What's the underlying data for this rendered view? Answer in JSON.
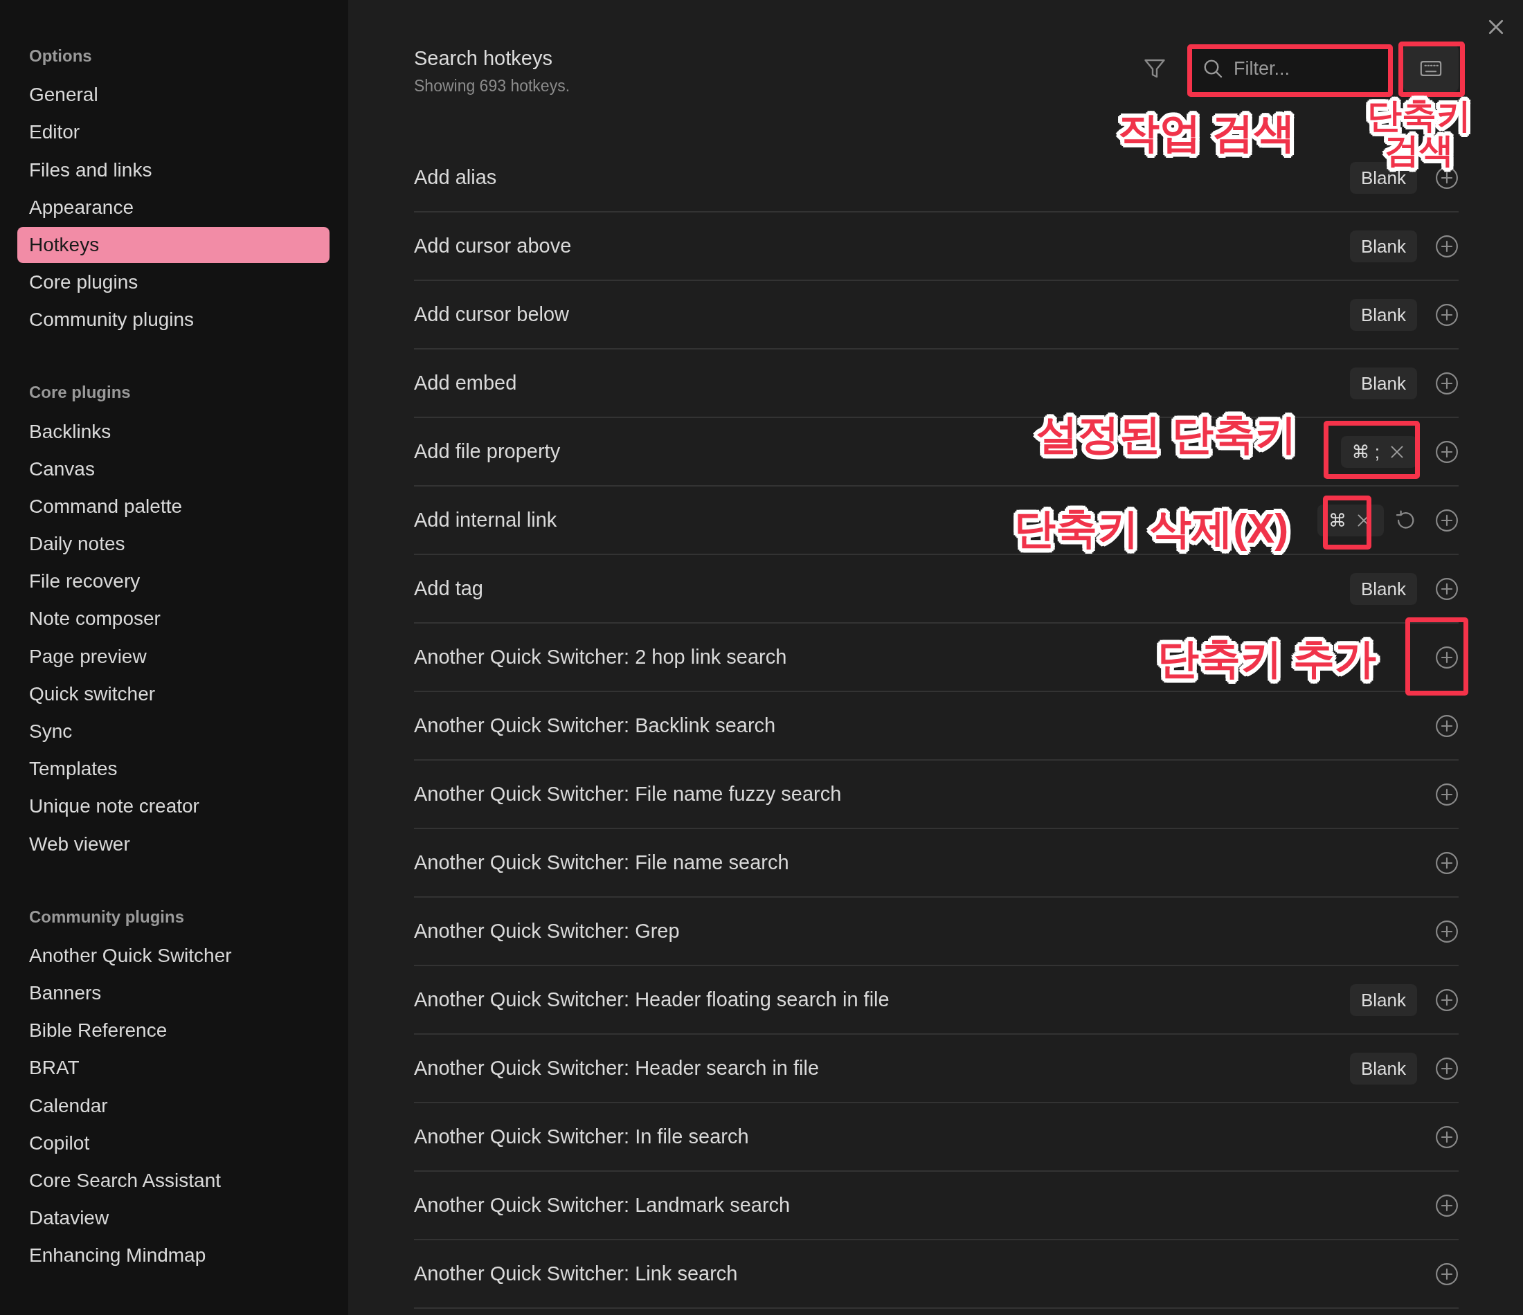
{
  "sidebar": {
    "sections": [
      {
        "heading": "Options",
        "items": [
          {
            "label": "General",
            "selected": false
          },
          {
            "label": "Editor",
            "selected": false
          },
          {
            "label": "Files and links",
            "selected": false
          },
          {
            "label": "Appearance",
            "selected": false
          },
          {
            "label": "Hotkeys",
            "selected": true
          },
          {
            "label": "Core plugins",
            "selected": false
          },
          {
            "label": "Community plugins",
            "selected": false
          }
        ]
      },
      {
        "heading": "Core plugins",
        "items": [
          {
            "label": "Backlinks",
            "selected": false
          },
          {
            "label": "Canvas",
            "selected": false
          },
          {
            "label": "Command palette",
            "selected": false
          },
          {
            "label": "Daily notes",
            "selected": false
          },
          {
            "label": "File recovery",
            "selected": false
          },
          {
            "label": "Note composer",
            "selected": false
          },
          {
            "label": "Page preview",
            "selected": false
          },
          {
            "label": "Quick switcher",
            "selected": false
          },
          {
            "label": "Sync",
            "selected": false
          },
          {
            "label": "Templates",
            "selected": false
          },
          {
            "label": "Unique note creator",
            "selected": false
          },
          {
            "label": "Web viewer",
            "selected": false
          }
        ]
      },
      {
        "heading": "Community plugins",
        "items": [
          {
            "label": "Another Quick Switcher",
            "selected": false
          },
          {
            "label": "Banners",
            "selected": false
          },
          {
            "label": "Bible Reference",
            "selected": false
          },
          {
            "label": "BRAT",
            "selected": false
          },
          {
            "label": "Calendar",
            "selected": false
          },
          {
            "label": "Copilot",
            "selected": false
          },
          {
            "label": "Core Search Assistant",
            "selected": false
          },
          {
            "label": "Dataview",
            "selected": false
          },
          {
            "label": "Enhancing Mindmap",
            "selected": false
          }
        ]
      }
    ]
  },
  "header": {
    "title": "Search hotkeys",
    "subtitle": "Showing 693 hotkeys.",
    "search": {
      "placeholder": "Filter..."
    }
  },
  "rows": [
    {
      "title": "Add alias",
      "hotkey": {
        "kind": "blank",
        "text": "Blank"
      },
      "reset": false
    },
    {
      "title": "Add cursor above",
      "hotkey": {
        "kind": "blank",
        "text": "Blank"
      },
      "reset": false
    },
    {
      "title": "Add cursor below",
      "hotkey": {
        "kind": "blank",
        "text": "Blank"
      },
      "reset": false
    },
    {
      "title": "Add embed",
      "hotkey": {
        "kind": "blank",
        "text": "Blank"
      },
      "reset": false
    },
    {
      "title": "Add file property",
      "hotkey": {
        "kind": "keys",
        "text": "⌘ ;"
      },
      "reset": false
    },
    {
      "title": "Add internal link",
      "hotkey": {
        "kind": "keys",
        "text": "⌘"
      },
      "reset": true
    },
    {
      "title": "Add tag",
      "hotkey": {
        "kind": "blank",
        "text": "Blank"
      },
      "reset": false
    },
    {
      "title": "Another Quick Switcher: 2 hop link search",
      "reset": false
    },
    {
      "title": "Another Quick Switcher: Backlink search",
      "reset": false
    },
    {
      "title": "Another Quick Switcher: File name fuzzy search",
      "reset": false
    },
    {
      "title": "Another Quick Switcher: File name search",
      "reset": false
    },
    {
      "title": "Another Quick Switcher: Grep",
      "reset": false
    },
    {
      "title": "Another Quick Switcher: Header floating search in file",
      "hotkey": {
        "kind": "blank",
        "text": "Blank"
      },
      "reset": false
    },
    {
      "title": "Another Quick Switcher: Header search in file",
      "hotkey": {
        "kind": "blank",
        "text": "Blank"
      },
      "reset": false
    },
    {
      "title": "Another Quick Switcher: In file search",
      "reset": false
    },
    {
      "title": "Another Quick Switcher: Landmark search",
      "reset": false
    },
    {
      "title": "Another Quick Switcher: Link search",
      "reset": false
    }
  ],
  "annotations": [
    {
      "label": "작업 검색"
    },
    {
      "label": "단축키 검색"
    },
    {
      "label": "설정된 단축키"
    },
    {
      "label": "단축키 삭제(X)"
    },
    {
      "label": "단축키 추가"
    }
  ]
}
